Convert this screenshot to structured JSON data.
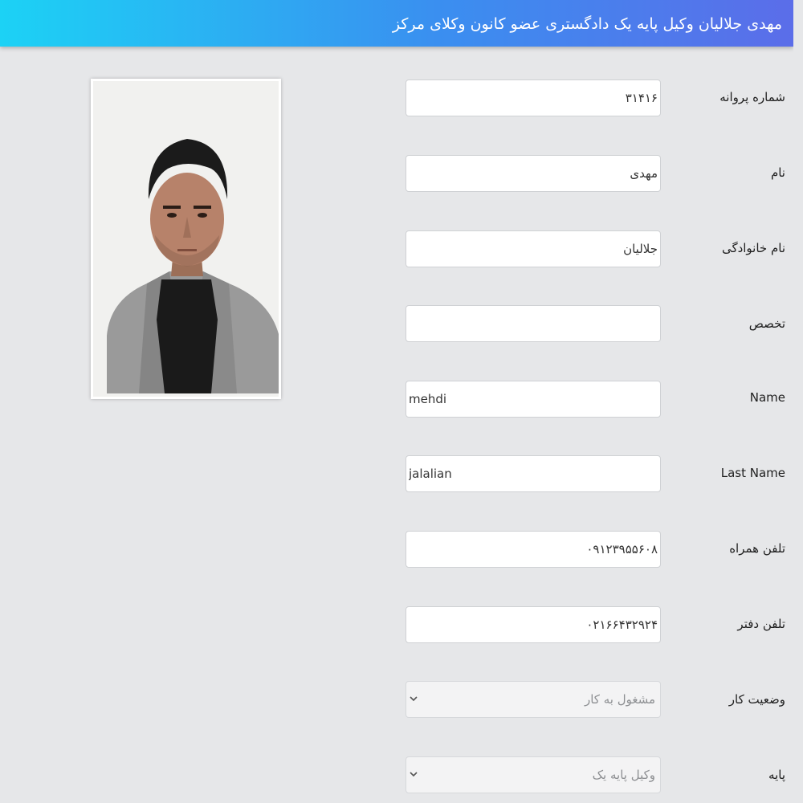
{
  "header": {
    "title": "مهدی جلالیان وکیل پایه یک دادگستری عضو کانون وکلای مرکز",
    "gradient_colors": [
      "#1cd2f5",
      "#3a8ff0",
      "#5b6de9"
    ]
  },
  "profile_photo": {
    "description_icon": "portrait-photo"
  },
  "form": {
    "license_number": {
      "label": "شماره پروانه",
      "value": "۳۱۴۱۶"
    },
    "first_name_fa": {
      "label": "نام",
      "value": "مهدی"
    },
    "last_name_fa": {
      "label": "نام خانوادگی",
      "value": "جلالیان"
    },
    "specialty": {
      "label": "تخصص",
      "value": ""
    },
    "first_name_en": {
      "label": "Name",
      "value": "mehdi"
    },
    "last_name_en": {
      "label": "Last Name",
      "value": "jalalian"
    },
    "mobile_phone": {
      "label": "تلفن همراه",
      "value": "۰۹۱۲۳۹۵۵۶۰۸"
    },
    "office_phone": {
      "label": "تلفن دفتر",
      "value": "۰۲۱۶۶۴۳۲۹۲۴"
    },
    "work_status": {
      "label": "وضعیت کار",
      "selected": "مشغول به کار"
    },
    "grade": {
      "label": "پایه",
      "selected": "وکیل پایه یک"
    }
  },
  "colors": {
    "page_background": "#e6e7e9",
    "input_background": "#ffffff",
    "select_background": "#f3f3f4"
  }
}
